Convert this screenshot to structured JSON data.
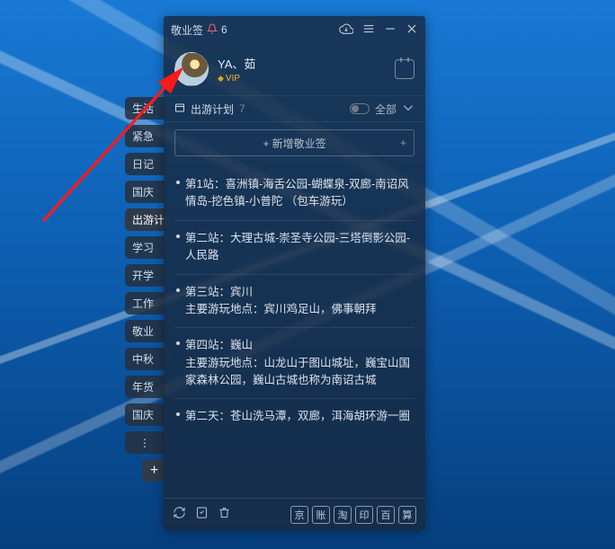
{
  "titlebar": {
    "appname": "敬业签",
    "notif_count": "6"
  },
  "profile": {
    "username": "YA、茹",
    "vip_text": "VIP"
  },
  "category": {
    "name": "出游计划",
    "count": "7",
    "filter": "全部"
  },
  "add_bar": {
    "placeholder": "+ 新增敬业签"
  },
  "side_tabs": [
    "生活",
    "紧急",
    "日记",
    "国庆",
    "出游计划",
    "学习",
    "开学",
    "工作",
    "敬业",
    "中秋",
    "年货",
    "国庆"
  ],
  "notes": [
    "第1站：喜洲镇-海舌公园-蝴蝶泉-双廊-南诏风情岛-挖色镇-小普陀 （包车游玩）",
    "第二站：大理古城-崇圣寺公园-三塔倒影公园-人民路",
    "第三站：宾川\n主要游玩地点：宾川鸡足山，佛事朝拜",
    "第四站：巍山\n主要游玩地点：山龙山于图山城址，巍宝山国家森林公园，巍山古城也称为南诏古城",
    "第二天：苍山洗马潭，双廊，洱海胡环游一圈"
  ],
  "services": [
    "京",
    "账",
    "淘",
    "印",
    "百",
    "算"
  ]
}
